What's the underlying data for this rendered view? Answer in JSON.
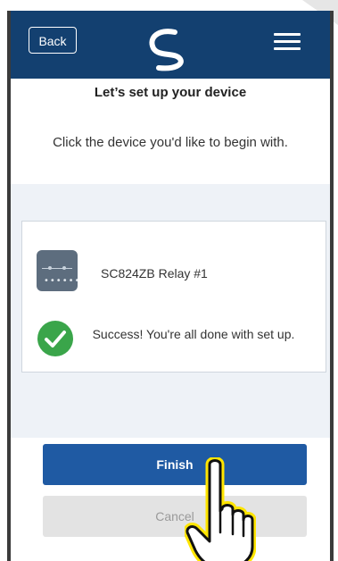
{
  "header": {
    "back_label": "Back",
    "logo_icon": "swirl-logo-icon",
    "menu_icon": "hamburger-menu-icon",
    "background_color": "#134070"
  },
  "page": {
    "title": "Let’s set up your device",
    "subtitle": "Click the device you'd like to begin with."
  },
  "device_card": {
    "device_icon": "relay-device-icon",
    "device_name": "SC824ZB Relay #1",
    "status_icon": "success-check-icon",
    "status_text": "Success! You're all done with set up.",
    "status_color": "#3aa54a"
  },
  "actions": {
    "finish_label": "Finish",
    "cancel_label": "Cancel",
    "finish_color": "#1f5aa3",
    "cancel_color": "#e3e3e3"
  },
  "cursor": {
    "icon": "hand-pointer-icon"
  }
}
